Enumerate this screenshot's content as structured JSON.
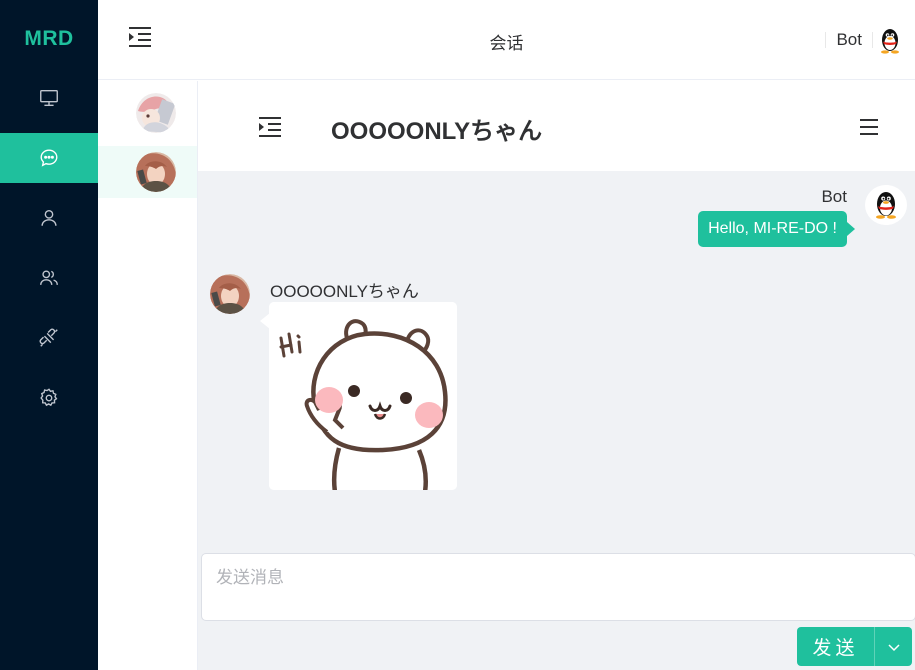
{
  "sidebar": {
    "logo": "MRD",
    "items": [
      {
        "name": "monitor-icon",
        "active": false
      },
      {
        "name": "chat-icon",
        "active": true
      },
      {
        "name": "user-icon",
        "active": false
      },
      {
        "name": "group-icon",
        "active": false
      },
      {
        "name": "plugin-icon",
        "active": false
      },
      {
        "name": "settings-icon",
        "active": false
      }
    ]
  },
  "header": {
    "title": "会话",
    "bot_name": "Bot"
  },
  "chat": {
    "title": "OOOOONLYちゃん",
    "messages": [
      {
        "side": "right",
        "sender": "Bot",
        "text": "Hello, MI-RE-DO !"
      },
      {
        "side": "left",
        "sender": "OOOOONLYちゃん",
        "image": "sticker-hi-bear"
      }
    ],
    "input_placeholder": "发送消息",
    "send_label": "发送"
  },
  "colors": {
    "accent": "#1fc09d",
    "sidebar_bg": "#001529",
    "chat_bg": "#f0f2f5"
  }
}
